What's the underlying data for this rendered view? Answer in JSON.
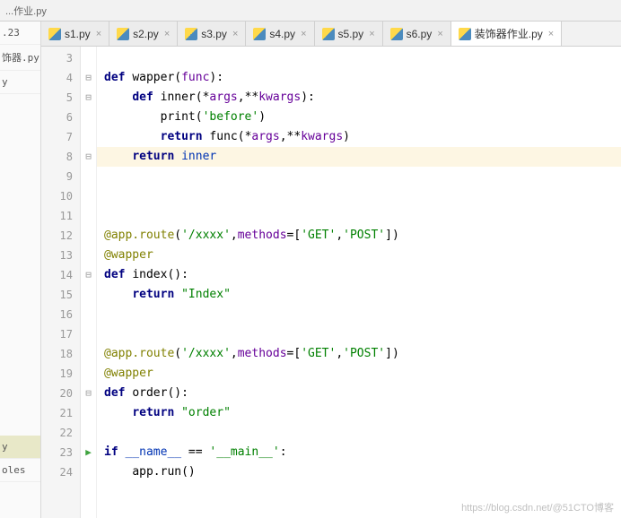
{
  "top_crumb": "...作业.py",
  "top_extra": ".23",
  "sidebar": {
    "items": [
      "饰器.py",
      "y",
      "y",
      "oles"
    ]
  },
  "tabs": [
    {
      "label": "s1.py",
      "active": false
    },
    {
      "label": "s2.py",
      "active": false
    },
    {
      "label": "s3.py",
      "active": false
    },
    {
      "label": "s4.py",
      "active": false
    },
    {
      "label": "s5.py",
      "active": false
    },
    {
      "label": "s6.py",
      "active": false
    },
    {
      "label": "装饰器作业.py",
      "active": true
    }
  ],
  "code": {
    "first_line": 3,
    "highlighted_line": 8,
    "run_marker_line": 23,
    "lines": [
      {
        "n": 3,
        "fold": "",
        "indent": 0,
        "tokens": []
      },
      {
        "n": 4,
        "fold": "⊟",
        "indent": 0,
        "tokens": [
          [
            "kw",
            "def "
          ],
          [
            "fn",
            "wapper"
          ],
          [
            "op",
            "("
          ],
          [
            "param",
            "func"
          ],
          [
            "op",
            "):"
          ]
        ]
      },
      {
        "n": 5,
        "fold": "⊟",
        "indent": 1,
        "tokens": [
          [
            "kw",
            "def "
          ],
          [
            "fn",
            "inner"
          ],
          [
            "op",
            "("
          ],
          [
            "op",
            "*"
          ],
          [
            "param",
            "args"
          ],
          [
            "op",
            ","
          ],
          [
            "op",
            "**"
          ],
          [
            "param",
            "kwargs"
          ],
          [
            "op",
            "):"
          ]
        ]
      },
      {
        "n": 6,
        "fold": "",
        "indent": 2,
        "tokens": [
          [
            "fn",
            "print"
          ],
          [
            "op",
            "("
          ],
          [
            "str",
            "'before'"
          ],
          [
            "op",
            ")"
          ]
        ]
      },
      {
        "n": 7,
        "fold": "",
        "indent": 2,
        "tokens": [
          [
            "kw",
            "return "
          ],
          [
            "fn",
            "func"
          ],
          [
            "op",
            "("
          ],
          [
            "op",
            "*"
          ],
          [
            "param",
            "args"
          ],
          [
            "op",
            ","
          ],
          [
            "op",
            "**"
          ],
          [
            "param",
            "kwargs"
          ],
          [
            "op",
            ")"
          ]
        ]
      },
      {
        "n": 8,
        "fold": "⊟",
        "indent": 1,
        "tokens": [
          [
            "kw",
            "return "
          ],
          [
            "ident-blue",
            "inner"
          ]
        ]
      },
      {
        "n": 9,
        "fold": "",
        "indent": 0,
        "tokens": []
      },
      {
        "n": 10,
        "fold": "",
        "indent": 0,
        "tokens": []
      },
      {
        "n": 11,
        "fold": "",
        "indent": 0,
        "tokens": []
      },
      {
        "n": 12,
        "fold": "",
        "indent": 0,
        "tokens": [
          [
            "deco",
            "@app.route"
          ],
          [
            "op",
            "("
          ],
          [
            "str",
            "'/xxxx'"
          ],
          [
            "op",
            ","
          ],
          [
            "param",
            "methods"
          ],
          [
            "op",
            "=["
          ],
          [
            "str",
            "'GET'"
          ],
          [
            "op",
            ","
          ],
          [
            "str",
            "'POST'"
          ],
          [
            "op",
            "])"
          ]
        ]
      },
      {
        "n": 13,
        "fold": "",
        "indent": 0,
        "tokens": [
          [
            "deco",
            "@wapper"
          ]
        ]
      },
      {
        "n": 14,
        "fold": "⊟",
        "indent": 0,
        "tokens": [
          [
            "kw",
            "def "
          ],
          [
            "fn",
            "index"
          ],
          [
            "op",
            "():"
          ]
        ]
      },
      {
        "n": 15,
        "fold": "",
        "indent": 1,
        "tokens": [
          [
            "kw",
            "return "
          ],
          [
            "str",
            "\"Index\""
          ]
        ]
      },
      {
        "n": 16,
        "fold": "",
        "indent": 0,
        "tokens": []
      },
      {
        "n": 17,
        "fold": "",
        "indent": 0,
        "tokens": []
      },
      {
        "n": 18,
        "fold": "",
        "indent": 0,
        "tokens": [
          [
            "deco",
            "@app.route"
          ],
          [
            "op",
            "("
          ],
          [
            "str",
            "'/xxxx'"
          ],
          [
            "op",
            ","
          ],
          [
            "param",
            "methods"
          ],
          [
            "op",
            "=["
          ],
          [
            "str",
            "'GET'"
          ],
          [
            "op",
            ","
          ],
          [
            "str",
            "'POST'"
          ],
          [
            "op",
            "])"
          ]
        ]
      },
      {
        "n": 19,
        "fold": "",
        "indent": 0,
        "tokens": [
          [
            "deco",
            "@wapper"
          ]
        ]
      },
      {
        "n": 20,
        "fold": "⊟",
        "indent": 0,
        "tokens": [
          [
            "kw",
            "def "
          ],
          [
            "fn",
            "order"
          ],
          [
            "op",
            "():"
          ]
        ]
      },
      {
        "n": 21,
        "fold": "",
        "indent": 1,
        "tokens": [
          [
            "kw",
            "return "
          ],
          [
            "str",
            "\"order\""
          ]
        ]
      },
      {
        "n": 22,
        "fold": "",
        "indent": 0,
        "tokens": []
      },
      {
        "n": 23,
        "fold": "⊟",
        "indent": 0,
        "tokens": [
          [
            "kw",
            "if "
          ],
          [
            "ident-blue",
            "__name__"
          ],
          [
            "op",
            " == "
          ],
          [
            "str",
            "'__main__'"
          ],
          [
            "op",
            ":"
          ]
        ]
      },
      {
        "n": 24,
        "fold": "",
        "indent": 1,
        "tokens": [
          [
            "fn",
            "app.run"
          ],
          [
            "op",
            "()"
          ]
        ]
      }
    ]
  },
  "watermark": "https://blog.csdn.net/@51CTO博客"
}
